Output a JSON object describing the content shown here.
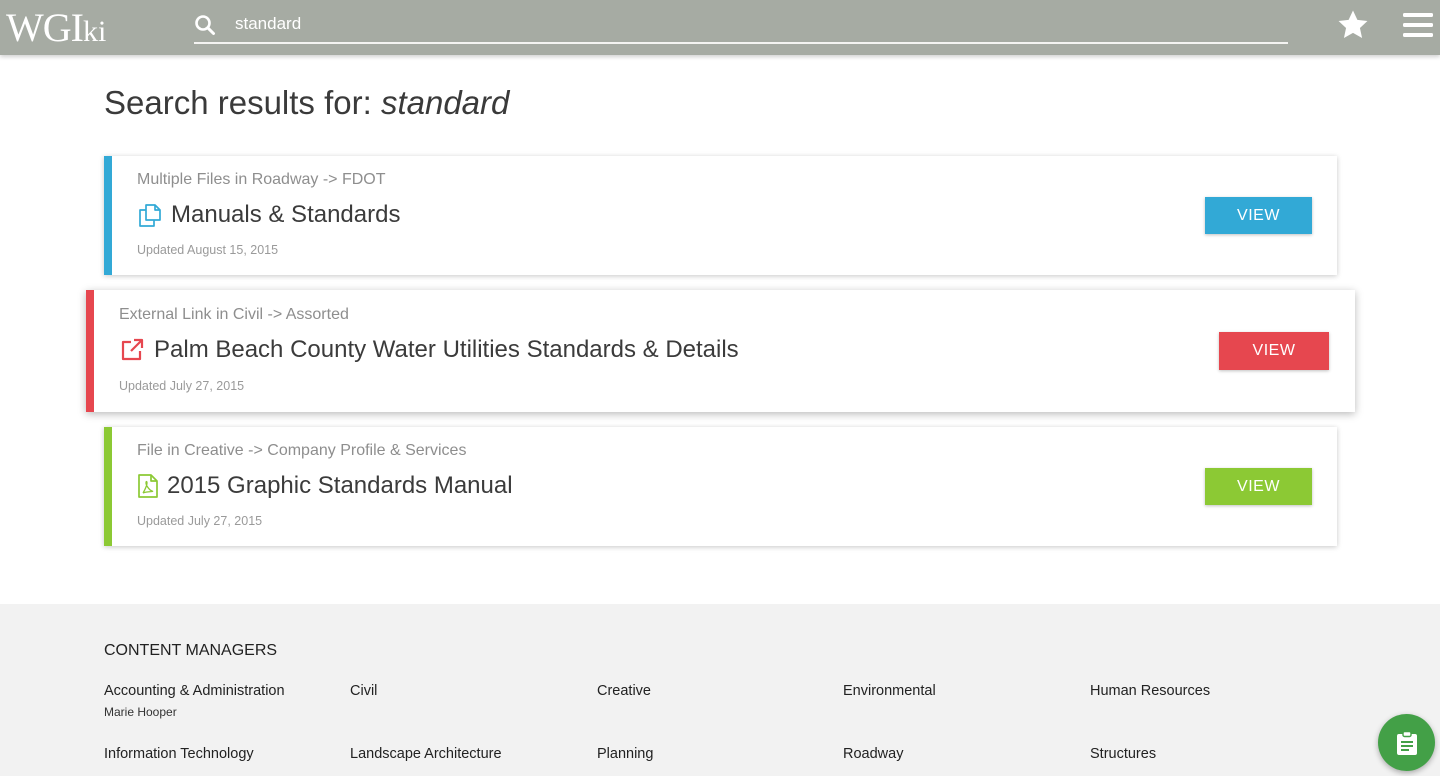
{
  "header": {
    "logo_main": "WGI",
    "logo_suffix": "ki",
    "search_value": "standard",
    "colors": {
      "bar": "#a6aba3"
    }
  },
  "page": {
    "title_prefix": "Search results for:",
    "title_query": "standard"
  },
  "results": [
    {
      "crumb": "Multiple Files in Roadway -> FDOT",
      "name": "Manuals & Standards",
      "updated": "Updated August 15, 2015",
      "view_label": "VIEW",
      "icon": "files-icon",
      "color": "#32a9d6"
    },
    {
      "crumb": "External Link in Civil -> Assorted",
      "name": "Palm Beach County Water Utilities Standards & Details",
      "updated": "Updated July 27, 2015",
      "view_label": "VIEW",
      "icon": "external-link-icon",
      "color": "#e6474f"
    },
    {
      "crumb": "File in Creative -> Company Profile & Services",
      "name": "2015 Graphic Standards Manual",
      "updated": "Updated July 27, 2015",
      "view_label": "VIEW",
      "icon": "pdf-file-icon",
      "color": "#8cc934"
    }
  ],
  "footer": {
    "heading": "CONTENT MANAGERS",
    "managers": [
      {
        "label": "Accounting & Administration",
        "person": "Marie Hooper"
      },
      {
        "label": "Civil"
      },
      {
        "label": "Creative"
      },
      {
        "label": "Environmental"
      },
      {
        "label": "Human Resources"
      },
      {
        "label": "Information Technology"
      },
      {
        "label": "Landscape Architecture"
      },
      {
        "label": "Planning"
      },
      {
        "label": "Roadway"
      },
      {
        "label": "Structures"
      }
    ]
  },
  "fab": {
    "icon": "clipboard-icon",
    "color": "#43a047"
  }
}
